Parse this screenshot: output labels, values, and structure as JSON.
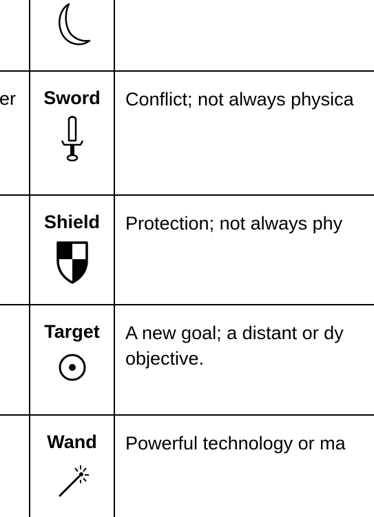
{
  "table": {
    "rows": [
      {
        "left": "",
        "name": "",
        "icon": "crescent-moon-icon",
        "desc": ""
      },
      {
        "left": "er",
        "name": "Sword",
        "icon": "sword-icon",
        "desc": "Conflict; not always physica"
      },
      {
        "left": "",
        "name": "Shield",
        "icon": "shield-icon",
        "desc": "Protection; not always phy"
      },
      {
        "left": "",
        "name": "Target",
        "icon": "target-icon",
        "desc": "A new goal; a distant or dy",
        "desc2": "objective."
      },
      {
        "left": "",
        "name": "Wand",
        "icon": "wand-icon",
        "desc": "Powerful technology or ma"
      }
    ]
  }
}
